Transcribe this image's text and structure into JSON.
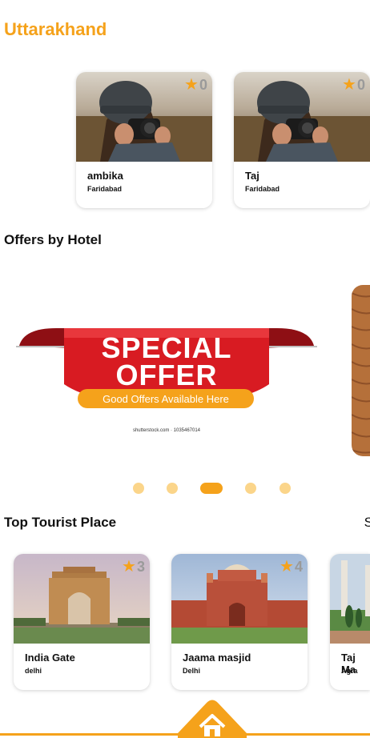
{
  "header": {
    "title": "Uttarakhand"
  },
  "hotels": [
    {
      "name": "ambika",
      "city": "Faridabad",
      "rating": "0"
    },
    {
      "name": "Taj",
      "city": "Faridabad",
      "rating": "0"
    }
  ],
  "offers": {
    "title": "Offers by Hotel",
    "banner_line1": "SPECIAL",
    "banner_line2": "OFFER",
    "banner_tag": "Good Offers Available Here",
    "banner_credit": "shutterstock.com · 1035467014"
  },
  "carousel": {
    "count": 5,
    "active_index": 2
  },
  "tourist": {
    "title": "Top Tourist Place",
    "see_all": "S",
    "places": [
      {
        "name": "India Gate",
        "city": "delhi",
        "rating": "3"
      },
      {
        "name": "Jaama masjid",
        "city": "Delhi",
        "rating": "4"
      },
      {
        "name": "Taj Ma",
        "city": "Agra",
        "rating": ""
      }
    ]
  },
  "nav": {
    "home_icon": "home-icon"
  },
  "colors": {
    "accent": "#f5a21b",
    "red": "#d81b22",
    "dot_inactive": "#fbd58a"
  }
}
